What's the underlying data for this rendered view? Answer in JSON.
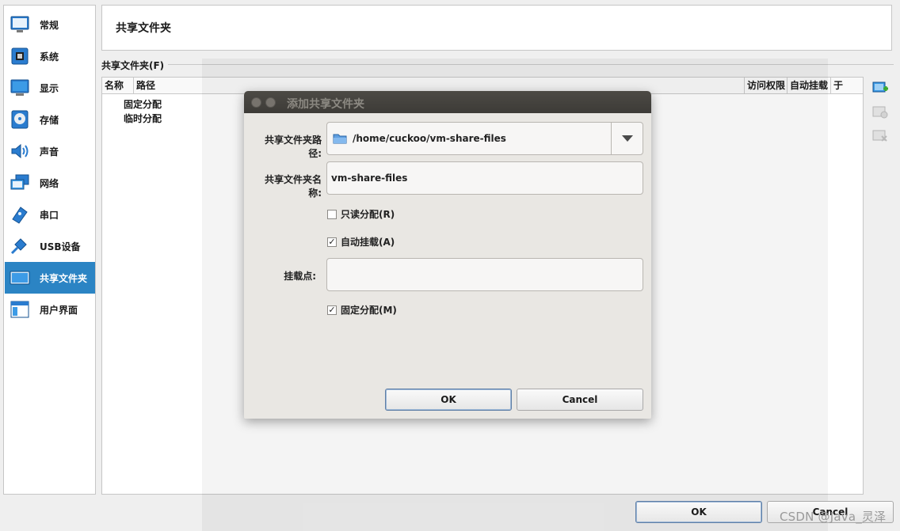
{
  "sidebar": {
    "items": [
      {
        "label": "常规",
        "icon": "general-icon"
      },
      {
        "label": "系统",
        "icon": "system-icon"
      },
      {
        "label": "显示",
        "icon": "display-icon"
      },
      {
        "label": "存储",
        "icon": "storage-icon"
      },
      {
        "label": "声音",
        "icon": "audio-icon"
      },
      {
        "label": "网络",
        "icon": "network-icon"
      },
      {
        "label": "串口",
        "icon": "serial-port-icon"
      },
      {
        "label": "USB设备",
        "icon": "usb-icon"
      },
      {
        "label": "共享文件夹",
        "icon": "shared-folders-icon",
        "active": true
      },
      {
        "label": "用户界面",
        "icon": "user-interface-icon"
      }
    ]
  },
  "header": {
    "title": "共享文件夹"
  },
  "folders": {
    "group_label": "共享文件夹(F)",
    "columns": [
      "名称",
      "路径",
      "访问权限",
      "自动挂载",
      "于"
    ],
    "tree": [
      "固定分配",
      "临时分配"
    ]
  },
  "dialog": {
    "title": "添加共享文件夹",
    "path_label": "共享文件夹路径:",
    "path_value": "/home/cuckoo/vm-share-files",
    "name_label": "共享文件夹名称:",
    "name_value": "vm-share-files",
    "readonly_label": "只读分配(R)",
    "readonly_checked": false,
    "automount_label": "自动挂载(A)",
    "automount_checked": true,
    "mountpoint_label": "挂载点:",
    "mountpoint_value": "",
    "permanent_label": "固定分配(M)",
    "permanent_checked": true,
    "ok_label": "OK",
    "cancel_label": "Cancel"
  },
  "footer": {
    "ok_label": "OK",
    "cancel_label": "Cancel"
  },
  "watermark": "CSDN @Java_灵泽",
  "colors": {
    "accent": "#2b84c4",
    "dialog_bg": "#e9e7e3",
    "titlebar": "#3d3b37"
  }
}
